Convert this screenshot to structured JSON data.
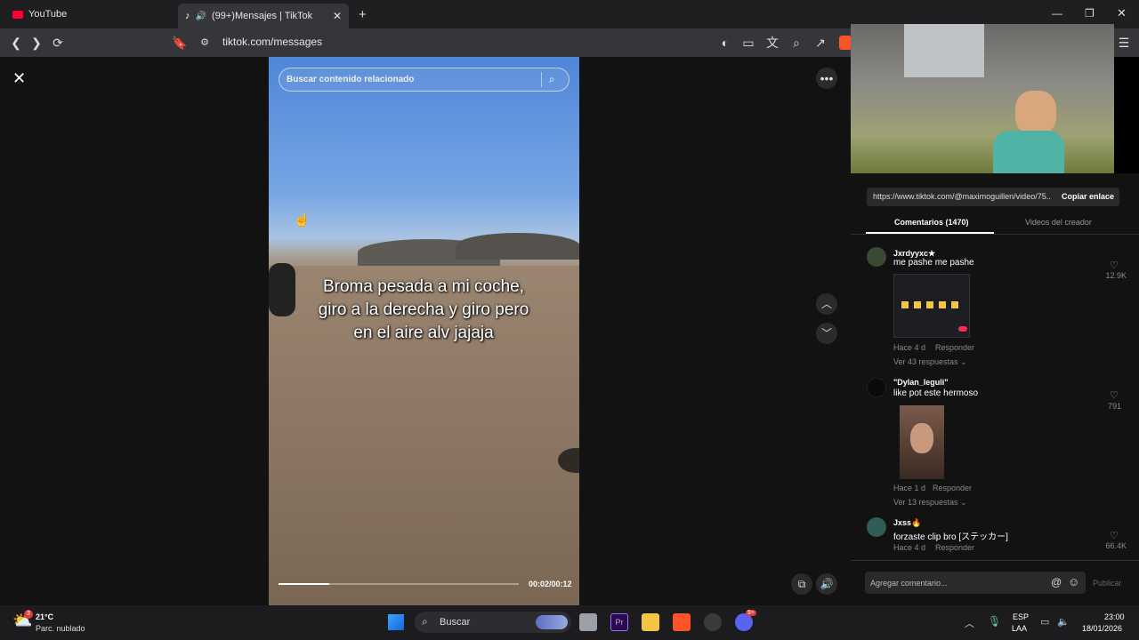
{
  "tabs": [
    {
      "title": "YouTube"
    },
    {
      "title": "(99+)Mensajes | TikTok"
    }
  ],
  "address": {
    "url": "tiktok.com/messages"
  },
  "video": {
    "search_placeholder": "Buscar contenido relacionado",
    "caption_lines": [
      "Broma pesada a mi coche,",
      "giro a la derecha y giro pero",
      "en el aire alv jajaja"
    ],
    "time": "00:02/00:12",
    "progress_fraction": 0.21
  },
  "panel": {
    "share_url": "https://www.tiktok.com/@maximoguillen/video/75...",
    "copy_link": "Copiar enlace",
    "tabs": [
      "Comentarios (1470)",
      "Videos del creador"
    ],
    "comments": [
      {
        "user": "Jxrdyyxc★",
        "text": "me pashe me pashe",
        "time": "Hace 4 d",
        "reply": "Responder",
        "more": "Ver 43 respuestas",
        "likes": "12.9K"
      },
      {
        "user": "\"Dylan_leguli\"",
        "text": "like pot este hermoso",
        "time": "Hace 1 d",
        "reply": "Responder",
        "more": "Ver 13 respuestas",
        "likes": "791"
      },
      {
        "user": "Jxss🔥",
        "text": "forzaste clip bro [ステッカー]",
        "time": "Hace 4 d",
        "reply": "Responder",
        "likes": "66.4K"
      }
    ],
    "comment_placeholder": "Agregar comentario...",
    "publish": "Publicar"
  },
  "taskbar": {
    "weather_temp": "21°C",
    "weather_desc": "Parc. nublado",
    "weather_badge": "3",
    "search": "Buscar",
    "lang1": "ESP",
    "lang2": "LAA",
    "clock_time": "23:00",
    "clock_date": "18/01/2026",
    "discord_badge": "9+"
  },
  "colors": {
    "youtube_red": "#ff0033",
    "brave_orange": "#fb542b",
    "tiktok_pink": "#fe2c55"
  }
}
